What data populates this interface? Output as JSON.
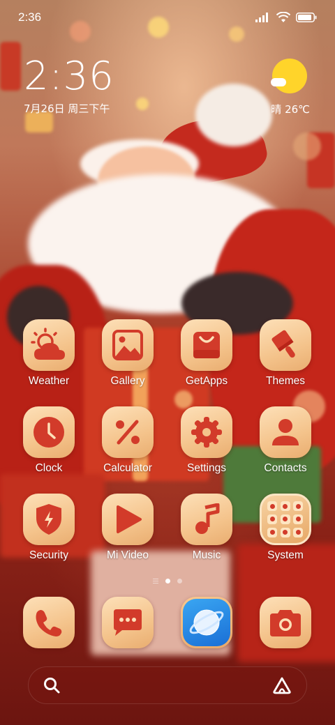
{
  "status_bar": {
    "time": "2:36",
    "battery_level": 0.85
  },
  "clock_widget": {
    "time": "2:36",
    "date": "7月26日 周三下午"
  },
  "weather_widget": {
    "text": "晴 26℃",
    "icon": "sunny-cloud-icon"
  },
  "apps_row1": [
    {
      "label": "Weather",
      "icon": "weather-icon"
    },
    {
      "label": "Gallery",
      "icon": "gallery-icon"
    },
    {
      "label": "GetApps",
      "icon": "getapps-bag-icon"
    },
    {
      "label": "Themes",
      "icon": "themes-brush-icon"
    }
  ],
  "apps_row2": [
    {
      "label": "Clock",
      "icon": "clock-icon"
    },
    {
      "label": "Calculator",
      "icon": "calculator-percent-icon"
    },
    {
      "label": "Settings",
      "icon": "settings-gear-icon"
    },
    {
      "label": "Contacts",
      "icon": "contacts-person-icon"
    }
  ],
  "apps_row3": [
    {
      "label": "Security",
      "icon": "security-shield-icon"
    },
    {
      "label": "Mi Video",
      "icon": "play-icon"
    },
    {
      "label": "Music",
      "icon": "music-note-icon"
    },
    {
      "label": "System",
      "icon": "folder-icon"
    }
  ],
  "dock": [
    {
      "icon": "phone-icon"
    },
    {
      "icon": "messages-icon"
    },
    {
      "icon": "browser-planet-icon"
    },
    {
      "icon": "camera-icon"
    }
  ],
  "page_indicator": {
    "pages": 2,
    "active": 1
  },
  "search_bar": {
    "left_icon": "search-icon",
    "right_icon": "assistant-icon"
  },
  "colors": {
    "icon_red": "#d23b2a",
    "icon_bg": "#f4c38b",
    "sun": "#ffd42a"
  }
}
